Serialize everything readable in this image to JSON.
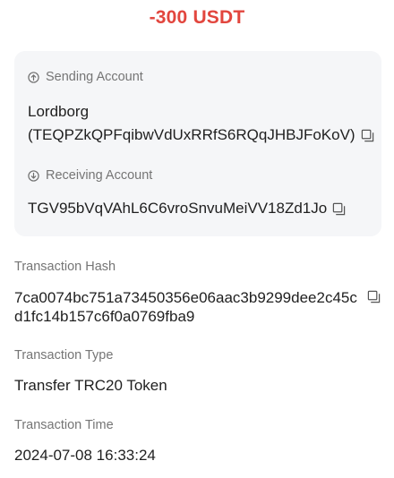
{
  "amount": "-300 USDT",
  "sending": {
    "label": "Sending Account",
    "name": "Lordborg",
    "address": "(TEQPZkQPFqibwVdUxRRfS6RQqJHBJFoKoV)"
  },
  "receiving": {
    "label": "Receiving Account",
    "address": "TGV95bVqVAhL6C6vroSnvuMeiVV18Zd1Jo"
  },
  "hash": {
    "label": "Transaction Hash",
    "value": "7ca0074bc751a73450356e06aac3b9299dee2c45cd1fc14b157c6f0a0769fba9"
  },
  "type": {
    "label": "Transaction Type",
    "value": "Transfer TRC20 Token"
  },
  "time": {
    "label": "Transaction Time",
    "value": "2024-07-08 16:33:24"
  },
  "icons": {
    "sending": "arrow-up-circle-icon",
    "receiving": "arrow-down-circle-icon",
    "copy": "copy-icon"
  },
  "colors": {
    "amount": "#e2463e",
    "card_bg": "#f5f6f8",
    "label": "#757575",
    "text": "#1f1f1f"
  }
}
